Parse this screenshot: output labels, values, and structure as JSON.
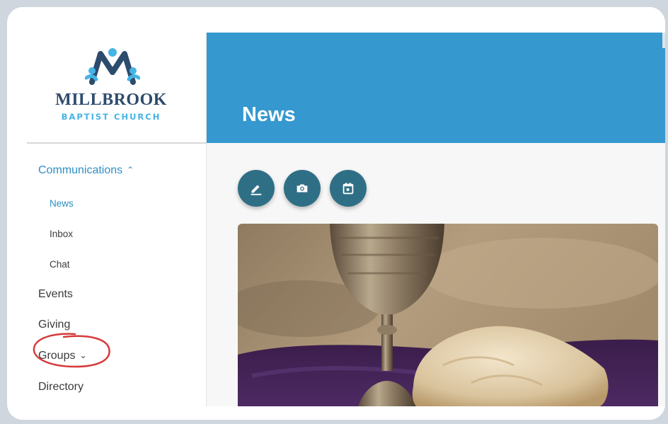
{
  "brand": {
    "name_line1": "MILLBROOK",
    "name_line2": "BAPTIST CHURCH",
    "primary_color": "#2d4b6d",
    "accent_color": "#44b4e6"
  },
  "sidebar": {
    "sections": [
      {
        "label": "Communications",
        "expanded": true,
        "icon": "chevron-up-icon"
      },
      {
        "label": "Events"
      },
      {
        "label": "Giving",
        "annotated": true
      },
      {
        "label": "Groups",
        "expanded": false,
        "icon": "chevron-down-icon"
      },
      {
        "label": "Directory"
      }
    ],
    "sub_items": [
      {
        "label": "News",
        "current": true
      },
      {
        "label": "Inbox"
      },
      {
        "label": "Chat"
      }
    ]
  },
  "header": {
    "title": "News",
    "background_color": "#3598cf"
  },
  "actions": [
    {
      "icon": "pencil-icon",
      "name": "compose-post-button"
    },
    {
      "icon": "camera-icon",
      "name": "photo-post-button"
    },
    {
      "icon": "calendar-icon",
      "name": "event-post-button"
    }
  ],
  "featured_image": {
    "subject": "communion-chalice-and-bread-photo"
  },
  "annotation": {
    "color": "#d63a3a"
  }
}
